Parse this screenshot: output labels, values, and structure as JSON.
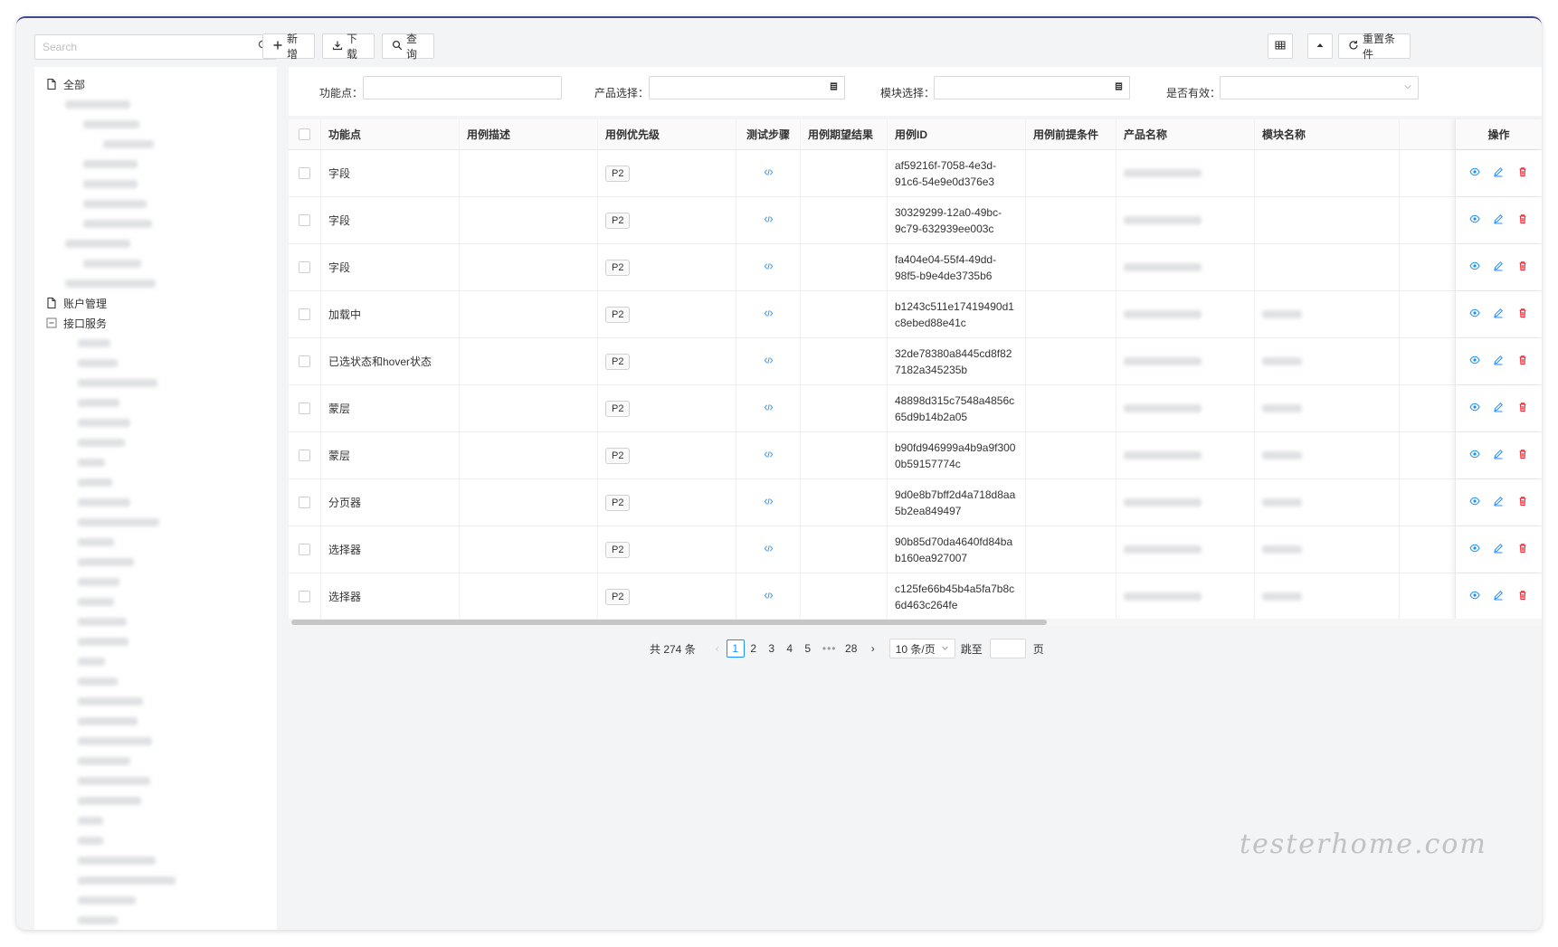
{
  "sidebar": {
    "search_placeholder": "Search",
    "tree": {
      "root": "全部",
      "account": "账户管理",
      "interface": "接口服务"
    }
  },
  "toolbar": {
    "add_label": "新增",
    "download_label": "下载",
    "query_label": "查询",
    "reset_label": "重置条件"
  },
  "filters": {
    "feature_label": "功能点：",
    "product_label": "产品选择：",
    "module_label": "模块选择：",
    "valid_label": "是否有效："
  },
  "table": {
    "columns": [
      "功能点",
      "用例描述",
      "用例优先级",
      "测试步骤",
      "用例期望结果",
      "用例ID",
      "用例前提条件",
      "产品名称",
      "模块名称"
    ],
    "ops_header": "操作",
    "rows": [
      {
        "feature": "字段",
        "priority": "P2",
        "id_line1": "af59216f-7058-4e3d-",
        "id_line2": "91c6-54e9e0d376e3",
        "module_visible": false
      },
      {
        "feature": "字段",
        "priority": "P2",
        "id_line1": "30329299-12a0-49bc-",
        "id_line2": "9c79-632939ee003c",
        "module_visible": false
      },
      {
        "feature": "字段",
        "priority": "P2",
        "id_line1": "fa404e04-55f4-49dd-",
        "id_line2": "98f5-b9e4de3735b6",
        "module_visible": false
      },
      {
        "feature": "加载中",
        "priority": "P2",
        "id_line1": "b1243c511e17419490d1",
        "id_line2": "c8ebed88e41c",
        "module_visible": true
      },
      {
        "feature": "已选状态和hover状态",
        "priority": "P2",
        "id_line1": "32de78380a8445cd8f82",
        "id_line2": "7182a345235b",
        "module_visible": true
      },
      {
        "feature": "蒙层",
        "priority": "P2",
        "id_line1": "48898d315c7548a4856c",
        "id_line2": "65d9b14b2a05",
        "module_visible": true
      },
      {
        "feature": "蒙层",
        "priority": "P2",
        "id_line1": "b90fd946999a4b9a9f300",
        "id_line2": "0b59157774c",
        "module_visible": true
      },
      {
        "feature": "分页器",
        "priority": "P2",
        "id_line1": "9d0e8b7bff2d4a718d8aa",
        "id_line2": "5b2ea849497",
        "module_visible": true
      },
      {
        "feature": "选择器",
        "priority": "P2",
        "id_line1": "90b85d70da4640fd84ba",
        "id_line2": "b160ea927007",
        "module_visible": true
      },
      {
        "feature": "选择器",
        "priority": "P2",
        "id_line1": "c125fe66b45b4a5fa7b8c",
        "id_line2": "6d463c264fe",
        "module_visible": true
      }
    ]
  },
  "pagination": {
    "total_text": "共 274 条",
    "pages": [
      "1",
      "2",
      "3",
      "4",
      "5"
    ],
    "ellipsis": "•••",
    "last_page": "28",
    "page_size": "10 条/页",
    "jump_label": "跳至",
    "page_suffix": "页"
  },
  "watermark": "testerhome.com",
  "colors": {
    "primary": "#1890ff",
    "danger": "#f5222d",
    "accent_top": "#3f4a8a"
  }
}
